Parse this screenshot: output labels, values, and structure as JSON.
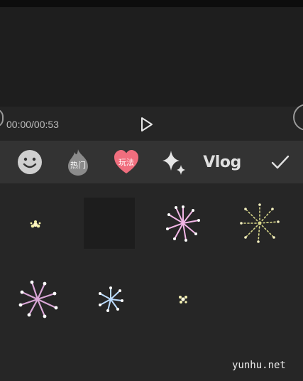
{
  "player": {
    "time": "00:00/00:53"
  },
  "categories": [
    {
      "name": "smiley-icon"
    },
    {
      "name": "hot-icon",
      "label": "热门"
    },
    {
      "name": "heart-icon",
      "label": "玩法",
      "color": "#f06e7e"
    },
    {
      "name": "sparkle-icon"
    },
    {
      "name": "vlog-tab",
      "label": "Vlog"
    },
    {
      "name": "check-icon"
    }
  ],
  "stickers": [
    {
      "name": "firework-small-yellow",
      "colors": [
        "#f4f1a8",
        "#fff6c8"
      ]
    },
    {
      "name": "empty-slot"
    },
    {
      "name": "firework-pink-white",
      "colors": [
        "#f2b6e6",
        "#ffffff"
      ]
    },
    {
      "name": "firework-gold-sparse",
      "colors": [
        "#d7d68a",
        "#f4f0c0"
      ]
    },
    {
      "name": "firework-pink-purple",
      "colors": [
        "#d9a6d6",
        "#ffffff"
      ]
    },
    {
      "name": "firework-blue-white",
      "colors": [
        "#bcdcff",
        "#ffffff"
      ]
    },
    {
      "name": "firework-tiny-yellow",
      "colors": [
        "#f3efb0",
        "#fffbe0"
      ]
    }
  ],
  "watermark": "yunhu.net"
}
